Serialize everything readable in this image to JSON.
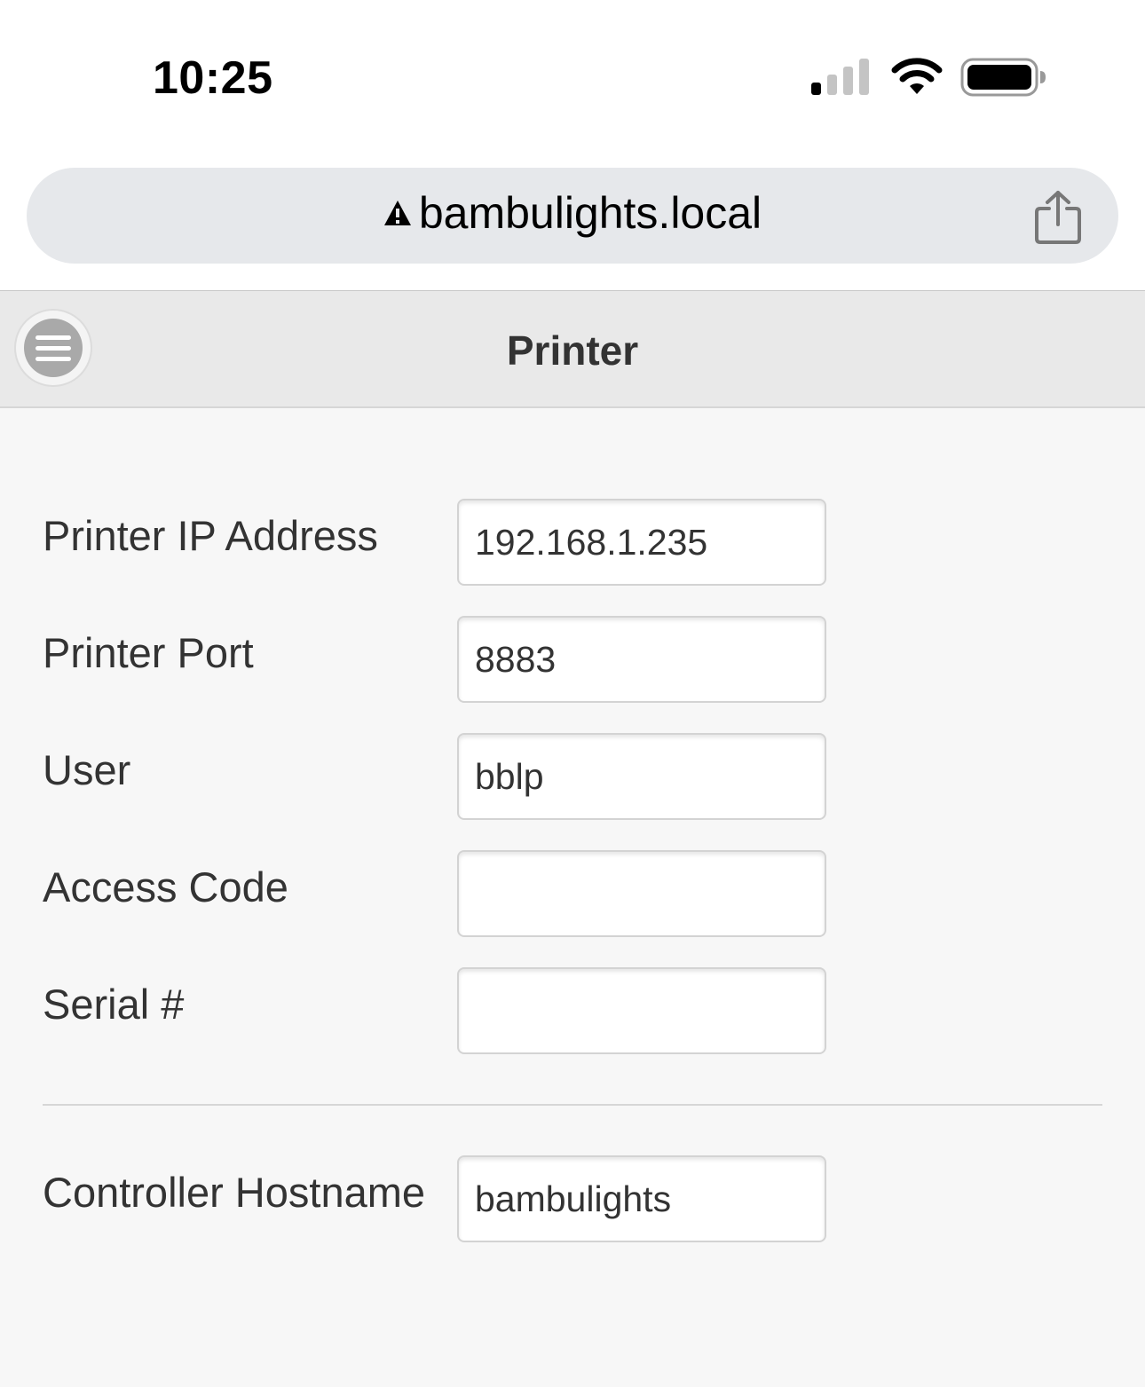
{
  "status_bar": {
    "time": "10:25",
    "icons": [
      "cellular-signal-icon",
      "wifi-icon",
      "battery-icon"
    ]
  },
  "browser": {
    "url": "bambulights.local",
    "icons": [
      "warning-icon",
      "share-icon"
    ]
  },
  "header": {
    "title": "Printer",
    "menu_icon": "menu-icon"
  },
  "form": {
    "fields": [
      {
        "label": "Printer IP Address",
        "value": "192.168.1.235"
      },
      {
        "label": "Printer Port",
        "value": "8883"
      },
      {
        "label": "User",
        "value": "bblp"
      },
      {
        "label": "Access Code",
        "value": ""
      },
      {
        "label": "Serial #",
        "value": ""
      }
    ],
    "hostname": {
      "label": "Controller Hostname",
      "value": "bambulights"
    }
  },
  "colors": {
    "page_bg": "#f7f7f7",
    "header_bg": "#e9e9e9",
    "url_bar_bg": "#e6e8eb",
    "text": "#333333"
  }
}
